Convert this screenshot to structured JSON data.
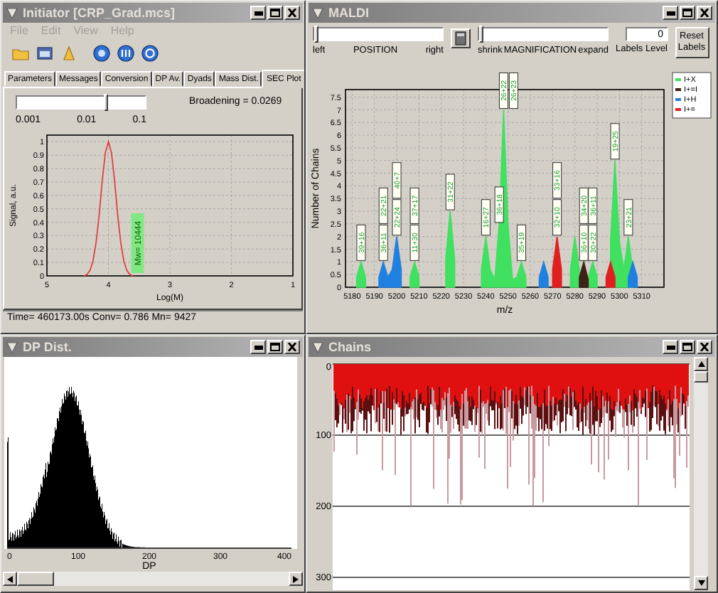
{
  "initiator": {
    "title": "Initiator [CRP_Grad.mcs]",
    "menu": [
      {
        "label": "File",
        "disabled": true
      },
      {
        "label": "Edit",
        "disabled": true
      },
      {
        "label": "View",
        "disabled": true
      },
      {
        "label": "Help",
        "disabled": true
      }
    ],
    "tabs": [
      {
        "label": "Parameters",
        "selected": false
      },
      {
        "label": "Messages",
        "selected": false
      },
      {
        "label": "Conversion",
        "selected": false
      },
      {
        "label": "DP Av.",
        "selected": false
      },
      {
        "label": "Dyads",
        "selected": false
      },
      {
        "label": "Mass Dist.",
        "selected": false
      },
      {
        "label": "SEC Plot",
        "selected": true
      }
    ],
    "broadening": {
      "level": 0.7,
      "ticks": [
        "0.001",
        "0.01",
        "0.1"
      ],
      "reading": "Broadening = 0.0269"
    },
    "sec_plot": {
      "chart_data": {
        "type": "line",
        "xlabel": "Log(M)",
        "ylabel": "Signal, a.u.",
        "grid": true,
        "x": [
          3.6,
          3.65,
          3.7,
          3.75,
          3.8,
          3.85,
          3.9,
          3.95,
          4.0,
          4.05,
          4.1,
          4.15,
          4.2,
          4.25,
          4.3,
          4.35,
          4.4
        ],
        "series": [
          {
            "color": "#e04040",
            "values": [
              0,
              0.01,
              0.04,
              0.11,
              0.25,
              0.46,
              0.71,
              0.92,
              1,
              0.92,
              0.71,
              0.46,
              0.25,
              0.11,
              0.04,
              0.01,
              0
            ]
          }
        ],
        "xlim": [
          5,
          1
        ],
        "ylim": [
          0,
          1.05
        ],
        "xticks": [
          5,
          4,
          3,
          2,
          1
        ],
        "yticks": [
          0,
          0.1,
          0.2,
          0.3,
          0.4,
          0.5,
          0.6,
          0.7,
          0.8,
          0.9,
          1
        ],
        "annotations": [
          "Mw= 10444"
        ]
      }
    },
    "status": "Time= 460173.00s  Conv= 0.786  Mn= 9427"
  },
  "maldi": {
    "title": "MALDI",
    "position": {
      "level": 0,
      "labels": [
        "left",
        "POSITION",
        "right"
      ]
    },
    "magnification": {
      "level": 0,
      "labels": [
        "shrink",
        "MAGNIFICATION",
        "expand"
      ]
    },
    "labels_level": {
      "value": "0",
      "label": "Labels Level"
    },
    "reset_button": "Reset Labels",
    "chart_data": {
      "type": "area",
      "xlabel": "m/z",
      "ylabel": "Number of Chains",
      "grid": true,
      "legend": "right",
      "x": [
        5182,
        5184,
        5186,
        5192,
        5194,
        5196,
        5198,
        5200,
        5202,
        5206,
        5208,
        5210,
        5222,
        5224,
        5226,
        5238,
        5240,
        5242,
        5244,
        5246,
        5248,
        5250,
        5252,
        5254,
        5256,
        5258,
        5264,
        5266,
        5268,
        5270,
        5272,
        5274,
        5278,
        5280,
        5282,
        5284,
        5286,
        5288,
        5290,
        5294,
        5296,
        5298,
        5300,
        5302,
        5304,
        5306,
        5308
      ],
      "series": [
        {
          "name": "I+X",
          "color": "#40e060",
          "values": [
            0.4,
            1,
            0.4,
            null,
            null,
            null,
            null,
            null,
            null,
            0.4,
            1,
            0.4,
            1.1,
            3,
            1.1,
            0.7,
            2,
            0.7,
            0.3,
            2.5,
            7,
            2.5,
            0.3,
            0.4,
            1,
            0.4,
            null,
            null,
            null,
            null,
            null,
            null,
            0.7,
            2,
            0.7,
            null,
            0.4,
            1,
            0.4,
            null,
            1.8,
            5,
            1.8,
            0.7,
            2,
            0.7,
            null
          ]
        },
        {
          "name": "I+=I",
          "color": "#402018",
          "values": [
            null,
            null,
            null,
            null,
            null,
            null,
            null,
            null,
            null,
            null,
            null,
            null,
            null,
            null,
            null,
            null,
            null,
            null,
            null,
            null,
            null,
            null,
            null,
            null,
            null,
            null,
            null,
            null,
            null,
            null,
            null,
            null,
            null,
            null,
            0.4,
            1,
            0.3,
            null,
            null,
            null,
            null,
            null,
            null,
            null,
            null,
            null,
            null
          ]
        },
        {
          "name": "I+H",
          "color": "#2080e0",
          "values": [
            null,
            null,
            null,
            0.4,
            1,
            0.4,
            0.7,
            2,
            0.7,
            null,
            null,
            null,
            null,
            null,
            null,
            null,
            null,
            null,
            null,
            null,
            null,
            null,
            null,
            null,
            null,
            null,
            0.4,
            1,
            0.4,
            null,
            null,
            null,
            null,
            null,
            null,
            null,
            null,
            null,
            null,
            null,
            null,
            null,
            null,
            null,
            0.4,
            1,
            0.4
          ]
        },
        {
          "name": "I+=",
          "color": "#e02020",
          "values": [
            null,
            null,
            null,
            null,
            null,
            null,
            null,
            null,
            null,
            null,
            null,
            null,
            null,
            null,
            null,
            null,
            null,
            null,
            null,
            null,
            null,
            null,
            null,
            null,
            null,
            null,
            null,
            null,
            null,
            0.7,
            2,
            0.7,
            null,
            null,
            null,
            null,
            null,
            null,
            null,
            0.4,
            1,
            0.4,
            null,
            null,
            null,
            null,
            null
          ]
        }
      ],
      "xlim": [
        5177,
        5320
      ],
      "ylim": [
        0,
        7.8
      ],
      "xticks": [
        5180,
        5190,
        5200,
        5210,
        5220,
        5230,
        5240,
        5250,
        5260,
        5270,
        5280,
        5290,
        5300,
        5310
      ],
      "yticks": [
        0,
        0.5,
        1,
        1.5,
        2,
        2.5,
        3,
        3.5,
        4,
        4.5,
        5,
        5.5,
        6,
        6.5,
        7,
        7.5
      ],
      "annotations": [
        {
          "x": 5184,
          "y": 1,
          "text": "39+16"
        },
        {
          "x": 5194,
          "y": 1,
          "text": "36+11"
        },
        "22+21",
        {
          "x": 5200,
          "y": 2,
          "text": "22+24"
        },
        "40+7",
        {
          "x": 5208,
          "y": 1,
          "text": "11+30"
        },
        "37+17",
        {
          "x": 5224,
          "y": 3,
          "text": "31+22"
        },
        {
          "x": 5240,
          "y": 2,
          "text": "16+27"
        },
        {
          "x": 5246,
          "y": 2.5,
          "text": "36+18"
        },
        {
          "x": 5248,
          "y": 7,
          "text": "26+22"
        },
        "26+23",
        {
          "x": 5256,
          "y": 1,
          "text": "35+19"
        },
        {
          "x": 5272,
          "y": 2,
          "text": "32+10"
        },
        "33+16",
        {
          "x": 5284,
          "y": 1,
          "text": "36+10"
        },
        "34+20",
        {
          "x": 5288,
          "y": 1,
          "text": "30+22"
        },
        "36+11",
        {
          "x": 5298,
          "y": 5,
          "text": "19+25"
        },
        {
          "x": 5304,
          "y": 2,
          "text": "23+21"
        }
      ]
    }
  },
  "dp_dist": {
    "title": "DP Dist.",
    "xlabel": "DP",
    "x_axis_labels": [
      "0",
      "100",
      "200",
      "300",
      "400"
    ]
  },
  "chains": {
    "title": "Chains",
    "y_axis_labels": [
      "0",
      "100",
      "200",
      "300"
    ]
  }
}
